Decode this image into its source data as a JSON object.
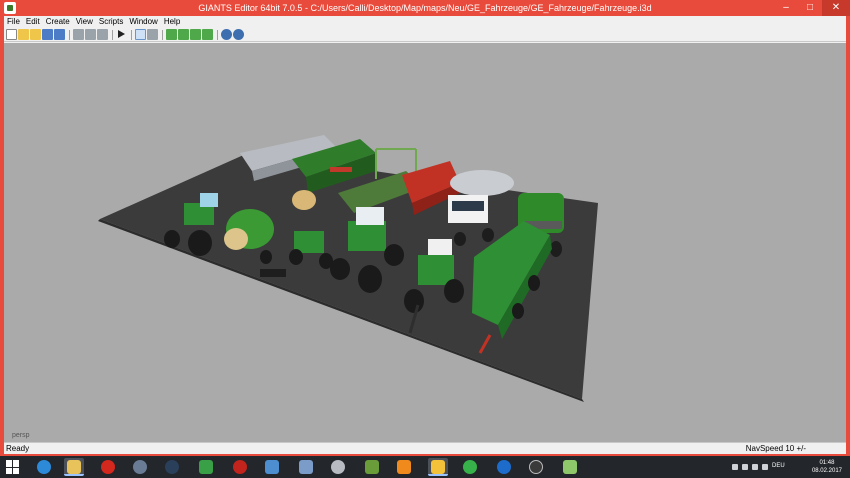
{
  "window": {
    "title": "GIANTS Editor 64bit 7.0.5 - C:/Users/Calli/Desktop/Map/maps/Neu/GE_Fahrzeuge/GE_Fahrzeuge/Fahrzeuge.i3d",
    "minimize_glyph": "–",
    "maximize_glyph": "□",
    "close_glyph": "✕"
  },
  "menu": {
    "items": [
      "File",
      "Edit",
      "Create",
      "View",
      "Scripts",
      "Window",
      "Help"
    ]
  },
  "toolbar": {
    "icons": [
      "new-file-icon",
      "open-file-icon",
      "open-recent-icon",
      "save-icon",
      "save-as-icon",
      "undo-icon",
      "redo-icon",
      "cut-icon",
      "play-icon",
      "select-tool-icon",
      "lock-icon",
      "terrain-sculpt-icon",
      "terrain-paint-icon",
      "foliage-paint-icon",
      "place-object-icon",
      "globe-icon",
      "network-icon"
    ]
  },
  "viewport": {
    "camera_label": "persp",
    "background": "#aaaaaa",
    "ground_color": "#3a3a3a"
  },
  "status": {
    "left": "Ready",
    "right": "NavSpeed 10 +/-"
  },
  "taskbar": {
    "apps": [
      "start-orb-icon",
      "explorer-icon",
      "opera-icon",
      "media-icon",
      "steam-icon",
      "game-icon",
      "record-icon",
      "network-icon",
      "display-icon",
      "disc-icon",
      "minecraft-icon",
      "vlc-icon",
      "giants-editor-icon",
      "whatsapp-icon",
      "teamviewer-icon",
      "obs-icon",
      "paint-icon"
    ],
    "language": "DEU",
    "time": "01:48",
    "date": "08.02.2017"
  }
}
